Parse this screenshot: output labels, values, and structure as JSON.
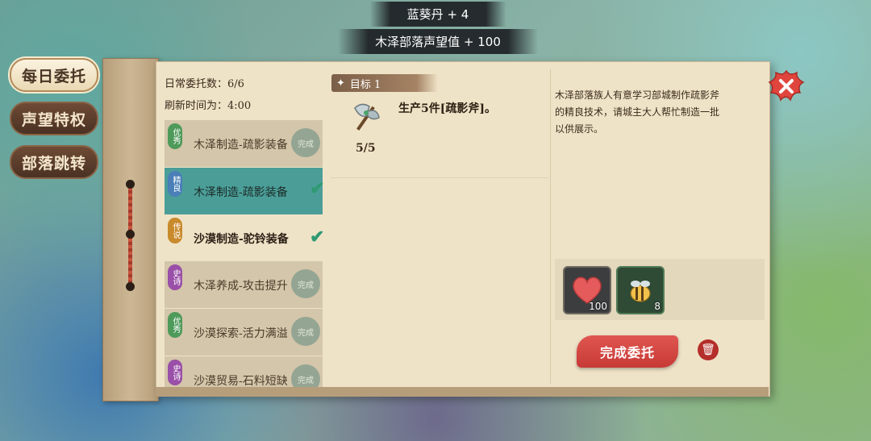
{
  "toasts": [
    "蓝葵丹 + 4",
    "木泽部落声望值 + 100"
  ],
  "sidebar": {
    "items": [
      {
        "label": "每日委托",
        "active": true
      },
      {
        "label": "声望特权",
        "active": false
      },
      {
        "label": "部落跳转",
        "active": false
      }
    ]
  },
  "info": {
    "daily_count": "日常委托数：6/6",
    "refresh_time": "刷新时间为：4:00"
  },
  "quests": [
    {
      "grade": "优秀",
      "grade_color": "#4e9a5a",
      "title": "木泽制造-疏影装备",
      "state": "完成"
    },
    {
      "grade": "精良",
      "grade_color": "#4a7fb8",
      "title": "木泽制造-疏影装备",
      "state": ""
    },
    {
      "grade": "传说",
      "grade_color": "#c98a2c",
      "title": "沙漠制造-驼铃装备",
      "state": ""
    },
    {
      "grade": "史诗",
      "grade_color": "#9a4fa8",
      "title": "木泽养成-攻击提升",
      "state": "完成"
    },
    {
      "grade": "优秀",
      "grade_color": "#4e9a5a",
      "title": "沙漠探索-活力满溢",
      "state": "完成"
    },
    {
      "grade": "史诗",
      "grade_color": "#9a4fa8",
      "title": "沙漠贸易-石料短缺",
      "state": "完成"
    }
  ],
  "goal": {
    "tab_label": "目标 1",
    "text": "生产5件[疏影斧]。",
    "progress": "5/5"
  },
  "description": "木泽部落族人有意学习部城制作疏影斧的精良技术，请城主大人帮忙制造一批以供展示。",
  "rewards": [
    {
      "icon": "heart-icon",
      "count": "100"
    },
    {
      "icon": "bee-pet-icon",
      "count": "8"
    }
  ],
  "complete_label": "完成委托"
}
